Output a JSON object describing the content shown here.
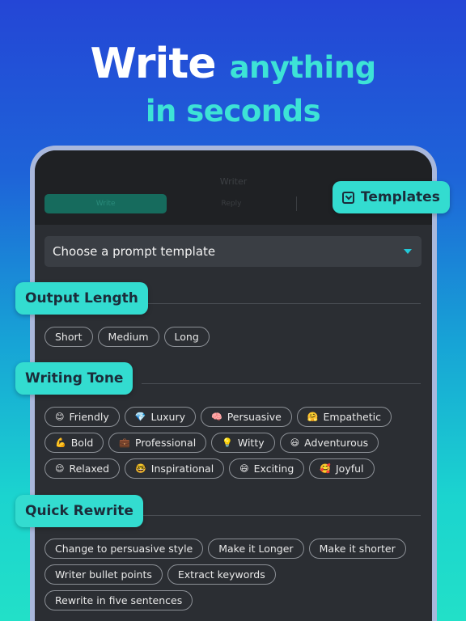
{
  "headline": {
    "word1": "Write",
    "word2": "anything",
    "line2": "in seconds"
  },
  "app": {
    "title": "Writer",
    "tabs": [
      "Write",
      "Reply",
      ""
    ]
  },
  "templates_badge": "Templates",
  "prompt_select": {
    "value": "Choose a prompt template"
  },
  "sections": {
    "output_length": {
      "title": "Output Length",
      "options": [
        "Short",
        "Medium",
        "Long"
      ]
    },
    "writing_tone": {
      "title": "Writing Tone",
      "options": [
        {
          "emoji": "😊",
          "label": "Friendly"
        },
        {
          "emoji": "💎",
          "label": "Luxury"
        },
        {
          "emoji": "🧠",
          "label": "Persuasive"
        },
        {
          "emoji": "🤗",
          "label": "Empathetic"
        },
        {
          "emoji": "💪",
          "label": "Bold"
        },
        {
          "emoji": "💼",
          "label": "Professional"
        },
        {
          "emoji": "💡",
          "label": "Witty"
        },
        {
          "emoji": "😃",
          "label": "Adventurous"
        },
        {
          "emoji": "😌",
          "label": "Relaxed"
        },
        {
          "emoji": "🤓",
          "label": "Inspirational"
        },
        {
          "emoji": "😄",
          "label": "Exciting"
        },
        {
          "emoji": "🥰",
          "label": "Joyful"
        }
      ]
    },
    "quick_rewrite": {
      "title": "Quick Rewrite",
      "options": [
        "Change to persuasive style",
        "Make it Longer",
        "Make it shorter",
        "Writer bullet points",
        "Extract keywords",
        "Rewrite in five sentences"
      ]
    }
  },
  "colors": {
    "accent": "#33dcd0",
    "screen_bg": "#2b2e33",
    "chip_border": "#8c9096"
  }
}
